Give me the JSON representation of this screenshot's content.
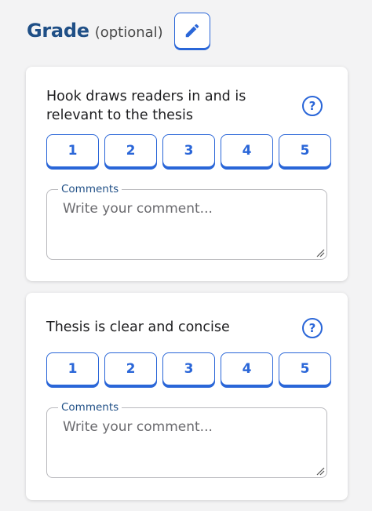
{
  "header": {
    "title": "Grade",
    "optional_label": "(optional)",
    "edit_icon": "pencil-icon"
  },
  "colors": {
    "accent": "#2a66d8",
    "title": "#1f4f86",
    "background": "#f3f3f4"
  },
  "criteria": [
    {
      "text": "Hook draws readers in and is relevant to the thesis",
      "help_icon": "question-mark-icon",
      "ratings": [
        "1",
        "2",
        "3",
        "4",
        "5"
      ],
      "comments": {
        "label": "Comments",
        "placeholder": "Write your comment...",
        "value": ""
      }
    },
    {
      "text": "Thesis is clear and concise",
      "help_icon": "question-mark-icon",
      "ratings": [
        "1",
        "2",
        "3",
        "4",
        "5"
      ],
      "comments": {
        "label": "Comments",
        "placeholder": "Write your comment...",
        "value": ""
      }
    }
  ]
}
